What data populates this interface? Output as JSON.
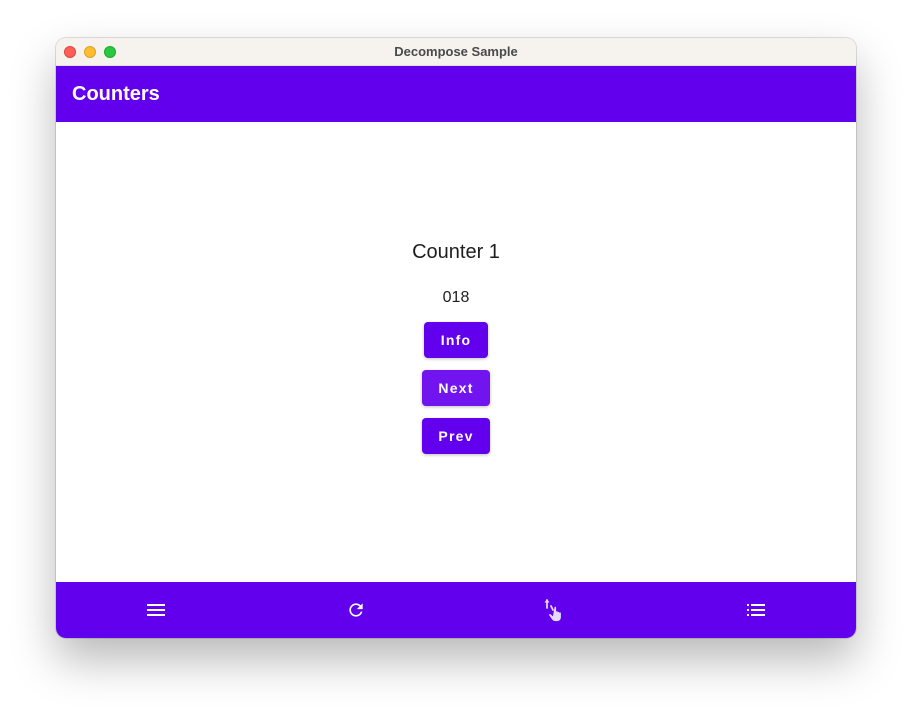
{
  "window": {
    "title": "Decompose Sample"
  },
  "colors": {
    "primary": "#6200ee",
    "primary_hover": "#7214f0",
    "traffic_close": "#fe5f57",
    "traffic_minimize": "#febc2e",
    "traffic_zoom": "#28c840",
    "nav_icon": "#ffffff",
    "nav_icon_selected": "#e6d8fc"
  },
  "app_bar": {
    "title": "Counters"
  },
  "counter": {
    "title": "Counter 1",
    "value": "018",
    "buttons": {
      "info": "Info",
      "next": "Next",
      "prev": "Prev"
    }
  },
  "bottom_nav": {
    "items": [
      {
        "icon": "menu-icon"
      },
      {
        "icon": "refresh-icon"
      },
      {
        "icon": "swipe-gesture-icon"
      },
      {
        "icon": "list-icon"
      }
    ]
  }
}
